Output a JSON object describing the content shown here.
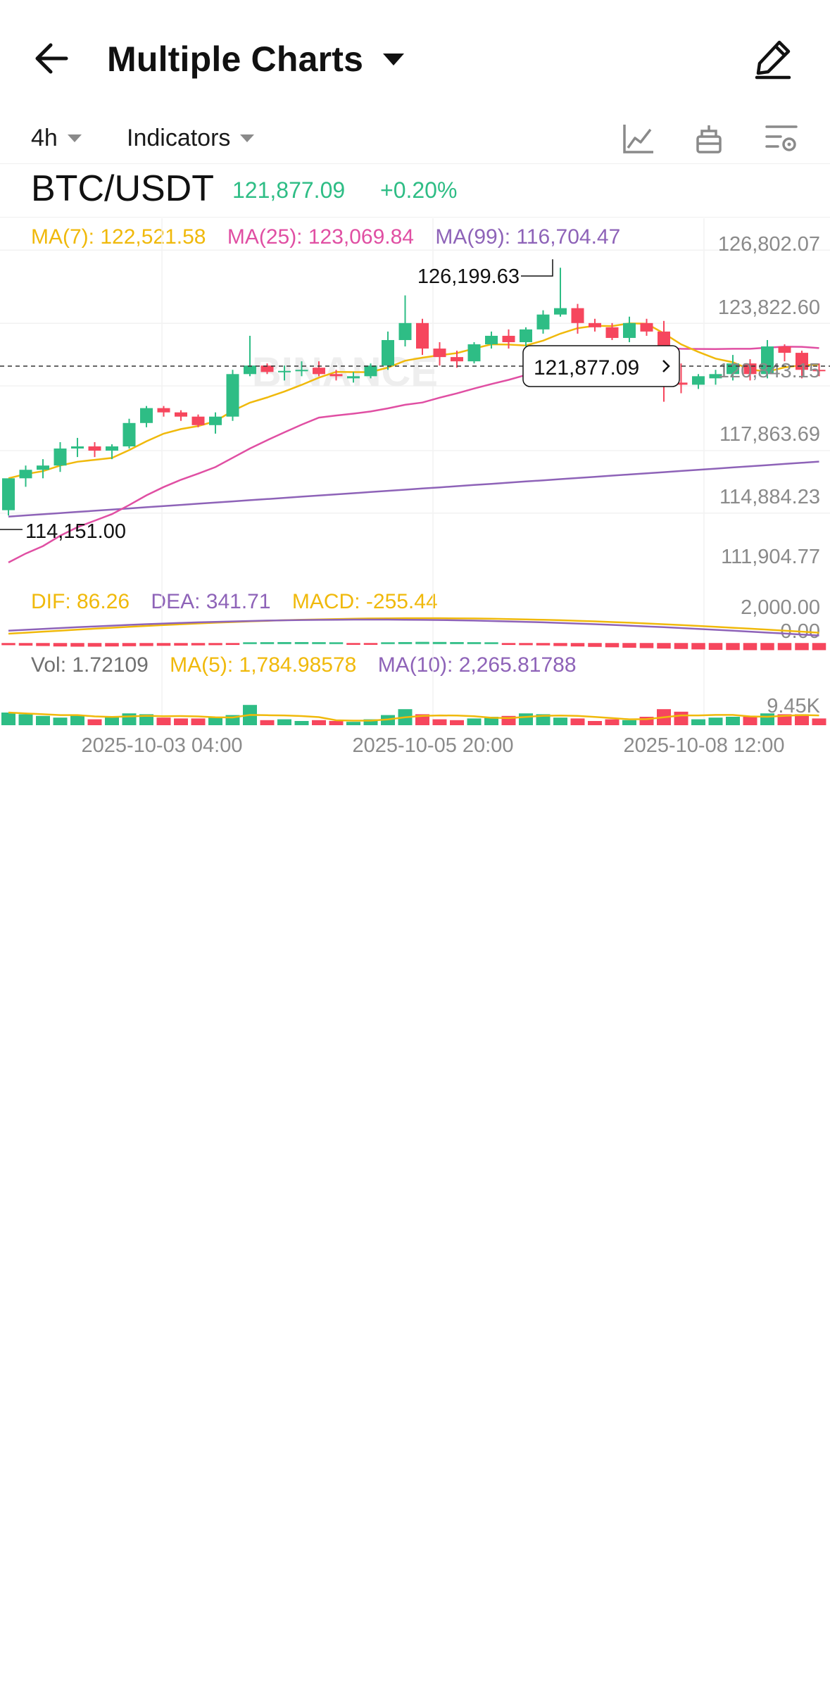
{
  "header": {
    "title": "Multiple Charts",
    "back_icon": "back-arrow-icon",
    "edit_icon": "edit-pencil-icon"
  },
  "toolbar": {
    "interval": "4h",
    "indicators_label": "Indicators",
    "icons": [
      "line-chart-icon",
      "depth-chart-icon",
      "chart-settings-icon"
    ]
  },
  "pair": {
    "symbol": "BTC/USDT",
    "last_price": "121,877.09",
    "change": "+0.20%"
  },
  "ma": {
    "ma7": "MA(7): 122,521.58",
    "ma25": "MA(25): 123,069.84",
    "ma99": "MA(99): 116,704.47"
  },
  "price_axis": [
    "126,802.07",
    "123,822.60",
    "120,843.15",
    "117,863.69",
    "114,884.23",
    "111,904.77"
  ],
  "markers": {
    "high": "126,199.63",
    "low": "114,151.00",
    "current": "121,877.09"
  },
  "watermark": "BINANCE",
  "macd": {
    "dif": "DIF: 86.26",
    "dea": "DEA: 341.71",
    "macd": "MACD: -255.44",
    "axis_top": "2,000.00",
    "axis_zero": "0.00"
  },
  "volume": {
    "vol": "Vol: 1.72109",
    "ma5": "MA(5): 1,784.98578",
    "ma10": "MA(10): 2,265.81788",
    "axis_label": "9.45K"
  },
  "time_axis": [
    "2025-10-03 04:00",
    "2025-10-05 20:00",
    "2025-10-08 12:00"
  ],
  "colors": {
    "up": "#2ebd85",
    "down": "#f6465d",
    "ma7": "#f0b90b",
    "ma25": "#e04fa3",
    "ma99": "#8e63b8"
  },
  "chart_data": {
    "type": "candlestick",
    "interval": "4h",
    "series": [
      {
        "name": "BTC/USDT",
        "candles": [
          {
            "o": 114400,
            "h": 115000,
            "l": 114151,
            "c": 115900
          },
          {
            "o": 115900,
            "h": 116500,
            "l": 115500,
            "c": 116300
          },
          {
            "o": 116300,
            "h": 116800,
            "l": 115900,
            "c": 116500
          },
          {
            "o": 116500,
            "h": 117600,
            "l": 116200,
            "c": 117300
          },
          {
            "o": 117300,
            "h": 117800,
            "l": 116900,
            "c": 117400
          },
          {
            "o": 117400,
            "h": 117600,
            "l": 116900,
            "c": 117200
          },
          {
            "o": 117200,
            "h": 117500,
            "l": 116800,
            "c": 117400
          },
          {
            "o": 117400,
            "h": 118700,
            "l": 117300,
            "c": 118500
          },
          {
            "o": 118500,
            "h": 119300,
            "l": 118300,
            "c": 119200
          },
          {
            "o": 119200,
            "h": 119300,
            "l": 118800,
            "c": 119000
          },
          {
            "o": 119000,
            "h": 119100,
            "l": 118600,
            "c": 118800
          },
          {
            "o": 118800,
            "h": 118900,
            "l": 118300,
            "c": 118400
          },
          {
            "o": 118400,
            "h": 119000,
            "l": 118000,
            "c": 118800
          },
          {
            "o": 118800,
            "h": 121000,
            "l": 118600,
            "c": 120800
          },
          {
            "o": 120800,
            "h": 122600,
            "l": 120700,
            "c": 121200
          },
          {
            "o": 121200,
            "h": 121300,
            "l": 120800,
            "c": 120900
          },
          {
            "o": 120900,
            "h": 121200,
            "l": 120500,
            "c": 120950
          },
          {
            "o": 120950,
            "h": 121400,
            "l": 120700,
            "c": 121000
          },
          {
            "o": 121100,
            "h": 121400,
            "l": 120700,
            "c": 120800
          },
          {
            "o": 120800,
            "h": 121000,
            "l": 120500,
            "c": 120700
          },
          {
            "o": 120600,
            "h": 120900,
            "l": 120400,
            "c": 120700
          },
          {
            "o": 120700,
            "h": 121300,
            "l": 120600,
            "c": 121200
          },
          {
            "o": 121200,
            "h": 122800,
            "l": 121000,
            "c": 122400
          },
          {
            "o": 122400,
            "h": 124500,
            "l": 122100,
            "c": 123200
          },
          {
            "o": 123200,
            "h": 123400,
            "l": 121700,
            "c": 122000
          },
          {
            "o": 122000,
            "h": 122300,
            "l": 121200,
            "c": 121600
          },
          {
            "o": 121600,
            "h": 121900,
            "l": 121100,
            "c": 121400
          },
          {
            "o": 121400,
            "h": 122300,
            "l": 121300,
            "c": 122200
          },
          {
            "o": 122200,
            "h": 122800,
            "l": 122000,
            "c": 122600
          },
          {
            "o": 122600,
            "h": 122900,
            "l": 122000,
            "c": 122300
          },
          {
            "o": 122300,
            "h": 123000,
            "l": 122100,
            "c": 122900
          },
          {
            "o": 122900,
            "h": 123800,
            "l": 122700,
            "c": 123600
          },
          {
            "o": 123600,
            "h": 125800,
            "l": 123500,
            "c": 123900
          },
          {
            "o": 123900,
            "h": 124100,
            "l": 122700,
            "c": 123200
          },
          {
            "o": 123200,
            "h": 123400,
            "l": 122800,
            "c": 123000
          },
          {
            "o": 123000,
            "h": 123200,
            "l": 122400,
            "c": 122500
          },
          {
            "o": 122500,
            "h": 123500,
            "l": 122300,
            "c": 123200
          },
          {
            "o": 123200,
            "h": 123400,
            "l": 122600,
            "c": 122800
          },
          {
            "o": 122800,
            "h": 123300,
            "l": 119500,
            "c": 120400
          },
          {
            "o": 120400,
            "h": 121300,
            "l": 119900,
            "c": 120300
          },
          {
            "o": 120300,
            "h": 120800,
            "l": 120100,
            "c": 120700
          },
          {
            "o": 120600,
            "h": 121000,
            "l": 120300,
            "c": 120800
          },
          {
            "o": 120800,
            "h": 121700,
            "l": 120500,
            "c": 121300
          },
          {
            "o": 121300,
            "h": 121500,
            "l": 120500,
            "c": 120800
          },
          {
            "o": 120800,
            "h": 122400,
            "l": 120600,
            "c": 122100
          },
          {
            "o": 122100,
            "h": 122200,
            "l": 121400,
            "c": 121800
          },
          {
            "o": 121800,
            "h": 121900,
            "l": 120600,
            "c": 121000
          },
          {
            "o": 121000,
            "h": 121300,
            "l": 120700,
            "c": 120950
          }
        ]
      }
    ],
    "ylim": [
      111904.77,
      126802.07
    ],
    "y_ticks": [
      126802.07,
      123822.6,
      120843.15,
      117863.69,
      114884.23,
      111904.77
    ],
    "x_labels": [
      "2025-10-03 04:00",
      "2025-10-05 20:00",
      "2025-10-08 12:00"
    ],
    "last_price": 121877.09,
    "high": 126199.63,
    "low": 114151.0,
    "volumes": [
      1500,
      1300,
      1100,
      900,
      1200,
      700,
      1000,
      1400,
      1300,
      900,
      800,
      800,
      900,
      1200,
      2400,
      600,
      700,
      500,
      600,
      500,
      400,
      700,
      1200,
      1900,
      1300,
      700,
      600,
      800,
      1000,
      1100,
      1400,
      1300,
      900,
      800,
      500,
      700,
      600,
      1000,
      1900,
      1600,
      700,
      900,
      1000,
      1000,
      1400,
      1300,
      1300,
      800
    ],
    "macd_hist": [
      -20,
      -40,
      -60,
      -80,
      -90,
      -90,
      -80,
      -70,
      -60,
      -50,
      -40,
      -30,
      -20,
      -10,
      0,
      5,
      10,
      10,
      5,
      0,
      -5,
      -5,
      0,
      10,
      20,
      15,
      10,
      5,
      0,
      -10,
      -20,
      -30,
      -60,
      -80,
      -100,
      -120,
      -140,
      -160,
      -180,
      -200,
      -220,
      -240,
      -250,
      -255,
      -255,
      -255,
      -255,
      -255
    ]
  }
}
